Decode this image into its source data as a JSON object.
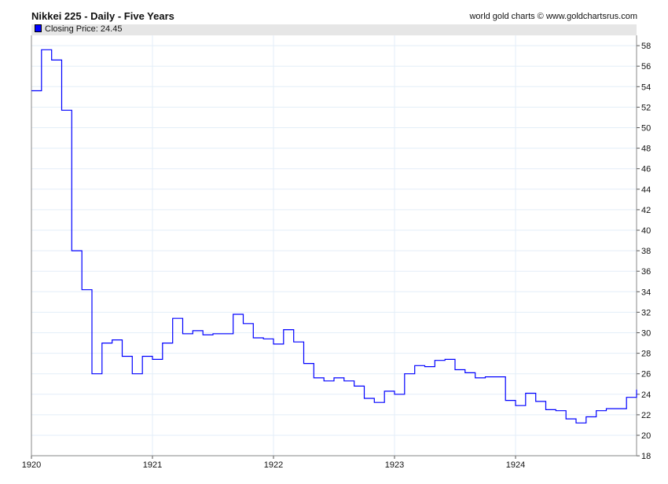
{
  "header": {
    "title": "Nikkei 225 - Daily - Five Years",
    "credit": "world gold charts © www.goldchartsrus.com"
  },
  "legend": {
    "label": "Closing Price: 24.45"
  },
  "colors": {
    "line": "#0000ff",
    "grid": "#e3eef8"
  },
  "chart_data": {
    "type": "line",
    "step": true,
    "title": "Nikkei 225 - Daily - Five Years",
    "ylim": [
      18,
      59
    ],
    "xlim": [
      1920,
      1925
    ],
    "yticks": [
      18,
      20,
      22,
      24,
      26,
      28,
      30,
      32,
      34,
      36,
      38,
      40,
      42,
      44,
      46,
      48,
      50,
      52,
      54,
      56,
      58
    ],
    "xticks": [
      "1920",
      "1921",
      "1922",
      "1923",
      "1924"
    ],
    "series": [
      {
        "name": "Closing Price",
        "last": 24.45,
        "monthly_values": [
          53.6,
          57.6,
          56.6,
          51.7,
          38.0,
          34.2,
          26.0,
          29.0,
          29.3,
          27.7,
          26.0,
          27.7,
          27.4,
          29.0,
          31.4,
          29.9,
          30.2,
          29.8,
          29.9,
          29.9,
          31.8,
          30.9,
          29.5,
          29.4,
          28.9,
          30.3,
          29.1,
          27.0,
          25.6,
          25.3,
          25.6,
          25.3,
          24.8,
          23.6,
          23.2,
          24.3,
          24.0,
          26.0,
          26.8,
          26.7,
          27.3,
          27.4,
          26.4,
          26.1,
          25.6,
          25.7,
          25.7,
          23.4,
          22.9,
          24.1,
          23.3,
          22.5,
          22.4,
          21.6,
          21.2,
          21.8,
          22.4,
          22.6,
          22.6,
          23.7
        ]
      }
    ]
  }
}
